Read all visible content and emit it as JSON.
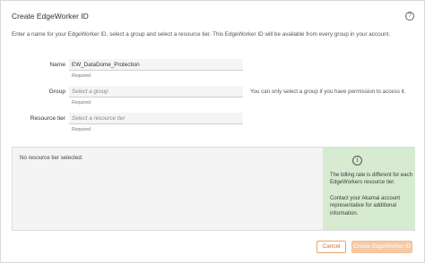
{
  "dialog": {
    "title": "Create EdgeWorker ID",
    "help_icon": "question-circle-icon",
    "intro": "Enter a name for your EdgeWorker ID, select a group and select a resource tier. This EdgeWorker ID will be available from every group in your account."
  },
  "form": {
    "name": {
      "label": "Name",
      "value": "EW_DataDome_Protection",
      "required": "Required"
    },
    "group": {
      "label": "Group",
      "placeholder": "Select a group",
      "required": "Required",
      "hint": "You can only select a group if you have permission to access it."
    },
    "tier": {
      "label": "Resource tier",
      "placeholder": "Select a resource tier",
      "required": "Required"
    }
  },
  "tier_panel": {
    "empty_text": "No resource tier selected.",
    "info_icon": "info-circle-icon",
    "info_paragraph_1": "The billing rate is different for each EdgeWorkers resource tier.",
    "info_paragraph_2": "Contact your Akamai account representative for additional information."
  },
  "actions": {
    "cancel_label": "Cancel",
    "create_label": "Create EdgeWorker ID"
  },
  "colors": {
    "accent": "#d7712a",
    "info_background": "#d6ebd0",
    "disabled_button": "#f6c9a5"
  }
}
